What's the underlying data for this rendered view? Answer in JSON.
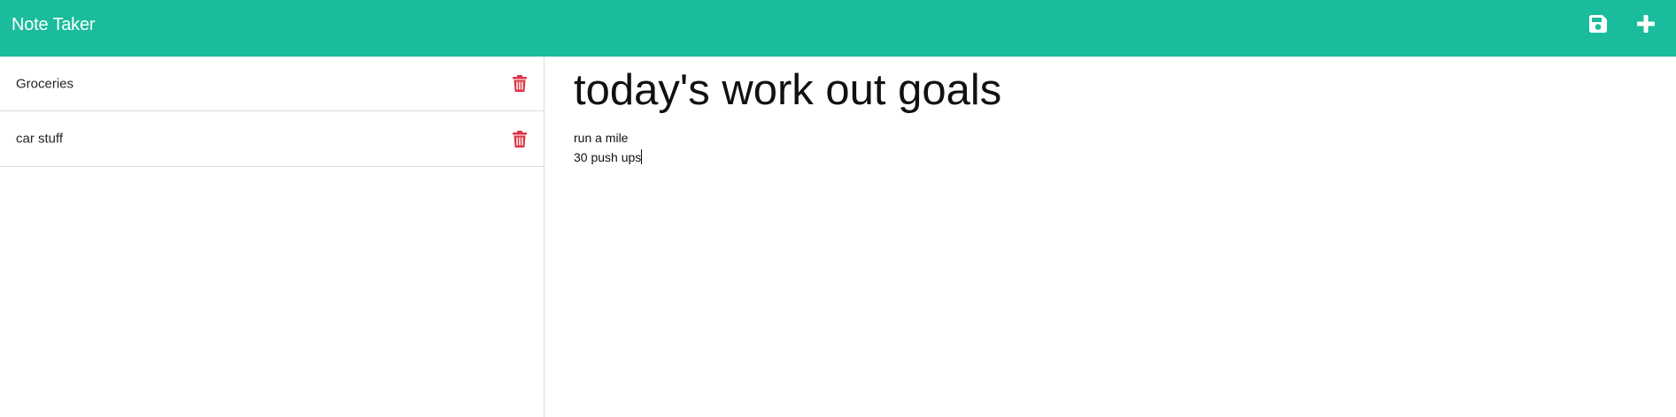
{
  "app": {
    "title": "Note Taker"
  },
  "toolbar": {
    "save_icon": "floppy-disk-icon",
    "new_icon": "plus-icon"
  },
  "colors": {
    "navbar": "#1abc9c",
    "delete": "#dc3545",
    "divider": "#dcdcdc"
  },
  "sidebar": {
    "notes": [
      {
        "title": "Groceries",
        "delete_icon": "trash-icon"
      },
      {
        "title": "car stuff",
        "delete_icon": "trash-icon"
      }
    ]
  },
  "editor": {
    "title": "today's work out goals",
    "body_lines": [
      "run a mile",
      "30 push ups"
    ]
  }
}
